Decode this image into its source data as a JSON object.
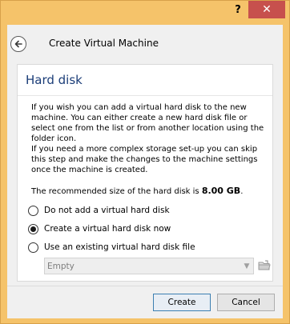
{
  "titlebar": {
    "help_label": "?",
    "close_label": "✕"
  },
  "header": {
    "title": "Create Virtual Machine"
  },
  "page": {
    "title": "Hard disk",
    "paragraph1": "If you wish you can add a virtual hard disk to the new machine. You can either create a new hard disk file or select one from the list or from another location using the folder icon.",
    "paragraph2": "If you need a more complex storage set-up you can skip this step and make the changes to the machine settings once the machine is created.",
    "recommended_prefix": "The recommended size of the hard disk is ",
    "recommended_value": "8.00 GB",
    "recommended_suffix": ".",
    "options": [
      {
        "label": "Do not add a virtual hard disk",
        "selected": false
      },
      {
        "label": "Create a virtual hard disk now",
        "selected": true
      },
      {
        "label": "Use an existing virtual hard disk file",
        "selected": false
      }
    ],
    "combo_value": "Empty"
  },
  "buttons": {
    "create": "Create",
    "cancel": "Cancel"
  },
  "colors": {
    "titlebar": "#f5c36a",
    "close": "#c7504d",
    "page_title": "#1b3d78"
  },
  "icons": {
    "back": "back-arrow-icon",
    "folder": "folder-icon",
    "dropdown": "chevron-down-icon"
  }
}
